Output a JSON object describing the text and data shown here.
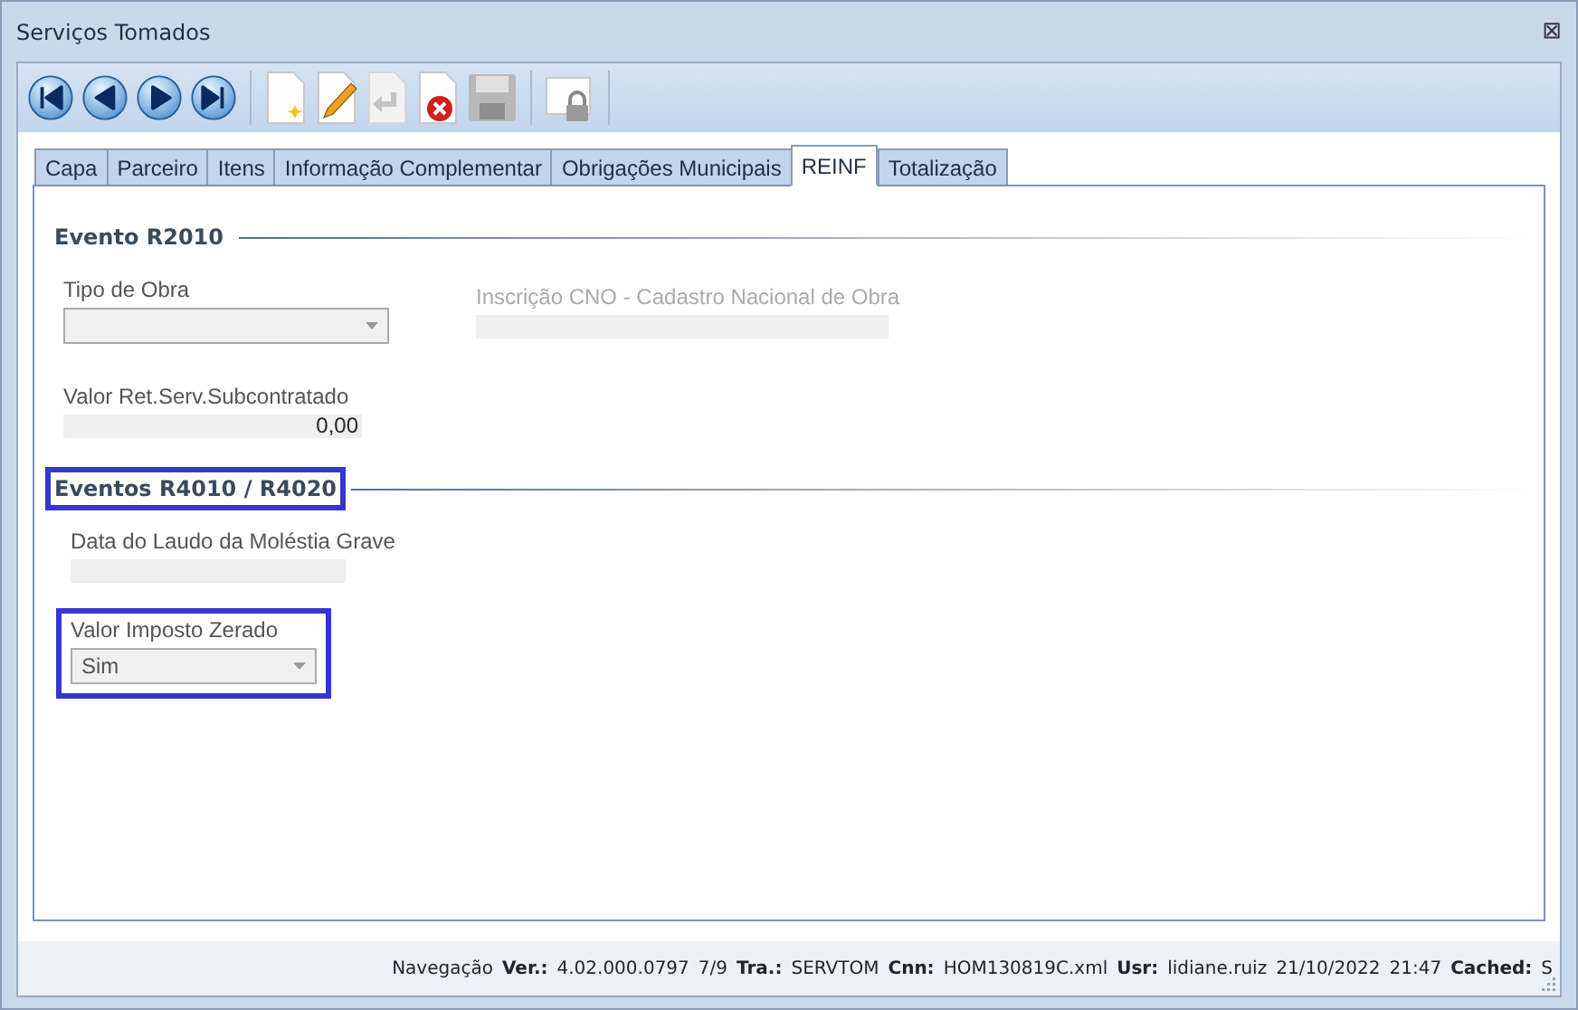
{
  "window": {
    "title": "Serviços Tomados",
    "close": "⊠"
  },
  "toolbar": [
    {
      "kind": "first",
      "disabled": false
    },
    {
      "kind": "prev",
      "disabled": false
    },
    {
      "kind": "next",
      "disabled": false
    },
    {
      "kind": "last",
      "disabled": false
    },
    {
      "kind": "new",
      "disabled": false
    },
    {
      "kind": "edit",
      "disabled": false
    },
    {
      "kind": "undo",
      "disabled": true
    },
    {
      "kind": "delete",
      "disabled": false
    },
    {
      "kind": "save",
      "disabled": true
    },
    {
      "kind": "lock",
      "disabled": false
    }
  ],
  "tabs": [
    {
      "label": "Capa",
      "selected": false
    },
    {
      "label": "Parceiro",
      "selected": false
    },
    {
      "label": "Itens",
      "selected": false
    },
    {
      "label": "Informação Complementar",
      "selected": false
    },
    {
      "label": "Obrigações Municipais",
      "selected": false
    },
    {
      "label": "REINF",
      "selected": true
    },
    {
      "label": "Totalização",
      "selected": false
    }
  ],
  "sections": [
    {
      "title": "Evento R2010",
      "highlighted": false,
      "fields": [
        {
          "label": "Tipo de Obra",
          "kind": "dropdown",
          "disabled": false,
          "highlighted": false
        },
        {
          "label": "Inscrição CNO - Cadastro Nacional de Obra",
          "kind": "text",
          "disabled": true,
          "highlighted": false
        },
        {
          "label": "Valor Ret.Serv.Subcontratado",
          "kind": "number",
          "value": "0,00",
          "disabled": false,
          "highlighted": false
        }
      ]
    },
    {
      "title": "Eventos R4010 / R4020",
      "highlighted": true,
      "fields": [
        {
          "label": "Data do Laudo da Moléstia Grave",
          "kind": "text",
          "disabled": false,
          "highlighted": false
        },
        {
          "label": "Valor Imposto Zerado",
          "kind": "dropdown",
          "value": "Sim",
          "disabled": false,
          "highlighted": true
        }
      ]
    }
  ],
  "status_bar": [
    {
      "value": "Navegação"
    },
    {
      "label": "Ver.:",
      "value": "4.02.000.0797"
    },
    {
      "value": "7/9"
    },
    {
      "label": "Tra.:",
      "value": "SERVTOM"
    },
    {
      "label": "Cnn:",
      "value": "HOM130819C.xml"
    },
    {
      "label": "Usr:",
      "value": "lidiane.ruiz"
    },
    {
      "value": "21/10/2022"
    },
    {
      "value": "21:47"
    },
    {
      "label": "Cached:",
      "value": "S"
    }
  ]
}
